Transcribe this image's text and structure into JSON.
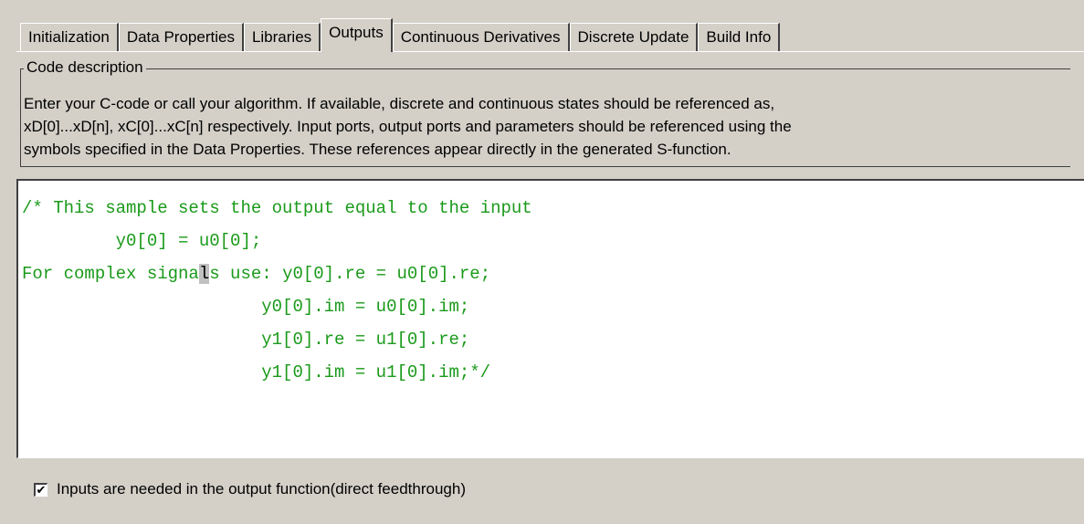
{
  "tabs": [
    {
      "label": "Initialization",
      "active": false
    },
    {
      "label": "Data Properties",
      "active": false
    },
    {
      "label": "Libraries",
      "active": false
    },
    {
      "label": "Outputs",
      "active": true
    },
    {
      "label": "Continuous Derivatives",
      "active": false
    },
    {
      "label": "Discrete Update",
      "active": false
    },
    {
      "label": "Build Info",
      "active": false
    }
  ],
  "code_description": {
    "legend": "Code description",
    "lines": [
      "Enter your C-code or call your algorithm. If available, discrete and continuous states should be referenced as,",
      "xD[0]...xD[n], xC[0]...xC[n] respectively. Input ports, output ports and parameters should be referenced using the",
      "symbols specified in the Data Properties. These references appear directly in the generated S-function."
    ]
  },
  "editor": {
    "line1": "/* This sample sets the output equal to the input",
    "line2": "         y0[0] = u0[0];",
    "line3_pre": "For complex signa",
    "line3_caret": "l",
    "line3_post": "s use: y0[0].re = u0[0].re;",
    "line4": "                       y0[0].im = u0[0].im;",
    "line5": "                       y1[0].re = u1[0].re;",
    "line6": "                       y1[0].im = u1[0].im;*/",
    "text_color": "#1a9a1a"
  },
  "direct_feedthrough": {
    "checked": true,
    "label": "Inputs are needed in the output function(direct feedthrough)"
  }
}
